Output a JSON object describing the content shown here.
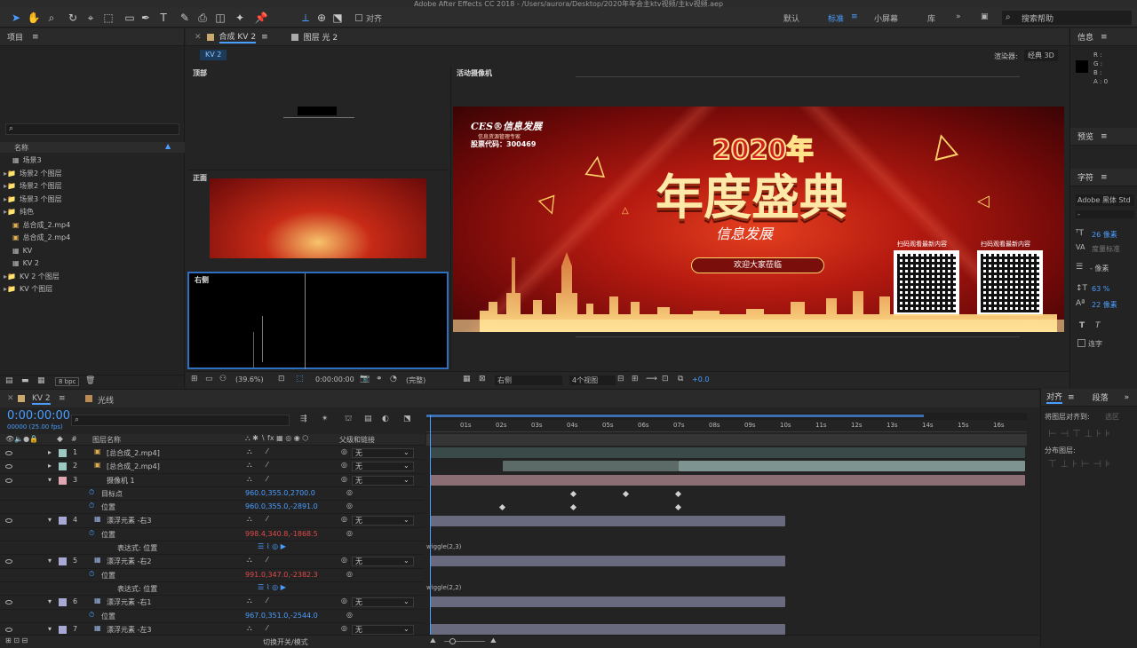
{
  "app": {
    "title": "Adobe After Effects CC 2018 - /Users/aurora/Desktop/2020年年会主ktv视频/主kv视频.aep",
    "workspaces": [
      "默认",
      "标准",
      "小屏幕",
      "库"
    ],
    "active_workspace": "标准",
    "search_help": "搜索帮助",
    "align_checkbox": "对齐"
  },
  "project": {
    "header": "项目",
    "search_placeholder": "",
    "column_name": "名称",
    "items": [
      {
        "name": "场景3",
        "type": "comp"
      },
      {
        "name": "场景2 个图层",
        "type": "folder"
      },
      {
        "name": "场景2 个图层",
        "type": "folder"
      },
      {
        "name": "场景3 个图层",
        "type": "folder"
      },
      {
        "name": "纯色",
        "type": "folder"
      },
      {
        "name": "总合成_2.mp4",
        "type": "video"
      },
      {
        "name": "总合成_2.mp4",
        "type": "video"
      },
      {
        "name": "KV",
        "type": "comp"
      },
      {
        "name": "KV 2",
        "type": "comp"
      },
      {
        "name": "KV 2 个图层",
        "type": "folder"
      },
      {
        "name": "KV 个图层",
        "type": "folder"
      }
    ],
    "bpc": "8 bpc"
  },
  "composition": {
    "tab_comp": "合成 KV 2",
    "tab_layer": "图层 光 2",
    "breadcrumb": "KV 2",
    "renderer_label": "渲染器:",
    "renderer_value": "经典 3D",
    "view_top": "顶部",
    "view_front": "正面",
    "view_right": "右侧",
    "view_active": "活动摄像机",
    "zoom": "(39.6%)",
    "timecode": "0:00:00:00",
    "quality": "(完整)",
    "view_select": "右侧",
    "view_count": "4个视图",
    "exposure": "+0.0"
  },
  "banner": {
    "company": "CES®信息发展",
    "subtitle": "信息资源管理专家",
    "stock": "股票代码：300469",
    "year": "2020年",
    "title": "年度盛典",
    "slogan": "信息发展",
    "welcome": "欢迎大家莅临",
    "qr_label_1": "扫码观看最新内容",
    "qr_label_2": "扫码观看最新内容"
  },
  "info_panel": {
    "header": "信息",
    "r": "R :",
    "g": "G :",
    "b": "B :",
    "a": "A : 0"
  },
  "preview_panel": {
    "header": "预览"
  },
  "character_panel": {
    "header": "字符",
    "font": "Adobe 黑体 Std",
    "style": "-",
    "size": "26 像素",
    "tracking_label": "度量标准",
    "leading": "- 像素",
    "vscale": "63 %",
    "baseline": "22 像素",
    "ligature": "连字"
  },
  "align_panel": {
    "tab_align": "对齐",
    "tab_paragraph": "段落",
    "align_to_label": "将图层对齐到:",
    "align_to_value": "选区",
    "distribute_label": "分布图层:"
  },
  "timeline": {
    "tab_comp": "KV 2",
    "tab_light": "光线",
    "timecode": "0:00:00:00",
    "frames": "00000 (25.00 fps)",
    "col_name": "图层名称",
    "col_parent": "父级和链接",
    "toggle_mode": "切换开关/模式",
    "ruler": [
      "01s",
      "02s",
      "03s",
      "04s",
      "05s",
      "06s",
      "07s",
      "08s",
      "09s",
      "10s",
      "11s",
      "12s",
      "13s",
      "14s",
      "15s",
      "16s"
    ],
    "layers": [
      {
        "num": "1",
        "name": "[总合成_2.mp4]",
        "color": "#9bc8c0",
        "type": "video",
        "parent": "无",
        "indent": 0
      },
      {
        "num": "2",
        "name": "[总合成_2.mp4]",
        "color": "#9bc8c0",
        "type": "video",
        "parent": "无",
        "indent": 0
      },
      {
        "num": "3",
        "name": "摄像机 1",
        "color": "#e0a6b2",
        "type": "camera",
        "parent": "无",
        "indent": 0
      },
      {
        "num": "",
        "name": "目标点",
        "value": "960.0,355.0,2700.0",
        "valueColor": "blue",
        "type": "prop",
        "indent": 1
      },
      {
        "num": "",
        "name": "位置",
        "value": "960.0,355.0,-2891.0",
        "valueColor": "blue",
        "type": "prop",
        "indent": 1
      },
      {
        "num": "4",
        "name": "漂浮元素 -右3",
        "color": "#a8a8d4",
        "type": "layer",
        "parent": "无",
        "indent": 0
      },
      {
        "num": "",
        "name": "位置",
        "value": "998.4,340.8,-1868.5",
        "valueColor": "red",
        "type": "prop",
        "indent": 1
      },
      {
        "num": "",
        "name": "表达式: 位置",
        "type": "expr",
        "indent": 2
      },
      {
        "num": "5",
        "name": "漂浮元素 -右2",
        "color": "#a8a8d4",
        "type": "layer",
        "parent": "无",
        "indent": 0
      },
      {
        "num": "",
        "name": "位置",
        "value": "991.0,347.0,-2382.3",
        "valueColor": "red",
        "type": "prop",
        "indent": 1
      },
      {
        "num": "",
        "name": "表达式: 位置",
        "type": "expr",
        "indent": 2
      },
      {
        "num": "6",
        "name": "漂浮元素 -右1",
        "color": "#a8a8d4",
        "type": "layer",
        "parent": "无",
        "indent": 0
      },
      {
        "num": "",
        "name": "位置",
        "value": "967.0,351.0,-2544.0",
        "valueColor": "blue",
        "type": "prop",
        "indent": 1
      },
      {
        "num": "7",
        "name": "漂浮元素 -左3",
        "color": "#a8a8d4",
        "type": "layer",
        "parent": "无",
        "indent": 0
      }
    ],
    "expr_1": "wiggle(2,3)",
    "expr_2": "wiggle(2,2)"
  }
}
